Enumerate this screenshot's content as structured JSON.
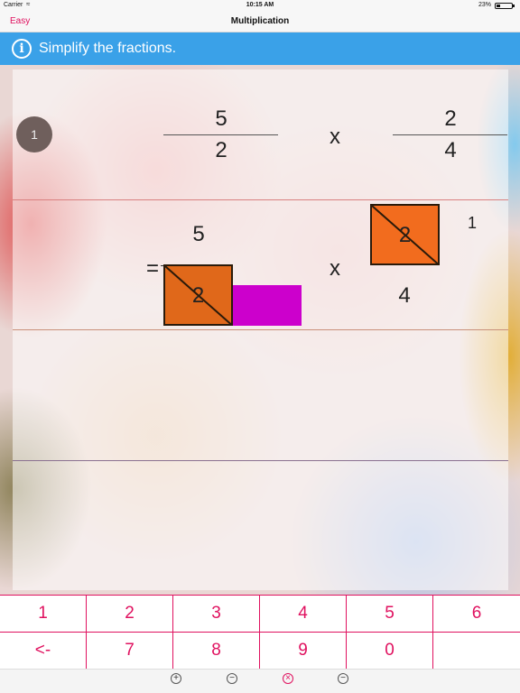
{
  "status_bar": {
    "carrier": "Carrier",
    "time": "10:15 AM",
    "battery": "23%",
    "battery_level": 0.23
  },
  "nav": {
    "back_label": "Easy",
    "title": "Multiplication"
  },
  "banner": {
    "icon": "info-icon",
    "icon_glyph": "i",
    "instruction": "Simplify the fractions."
  },
  "problem": {
    "number": "1",
    "fraction1": {
      "numerator": "5",
      "denominator": "2"
    },
    "operator": "x",
    "fraction2": {
      "numerator": "2",
      "denominator": "4"
    }
  },
  "work": {
    "equals": "=",
    "fraction1": {
      "numerator": "5",
      "denominator_crossed": "2"
    },
    "operator": "x",
    "fraction2": {
      "numerator_crossed": "2",
      "numerator_reduced": "1",
      "denominator": "4"
    }
  },
  "keypad": {
    "row1": [
      "1",
      "2",
      "3",
      "4",
      "5",
      "6"
    ],
    "row2": [
      "<-",
      "7",
      "8",
      "9",
      "0",
      ""
    ]
  },
  "toolbar": {
    "icons": [
      {
        "name": "zoom-in-icon",
        "glyph": "+"
      },
      {
        "name": "zoom-out-icon",
        "glyph": "−"
      },
      {
        "name": "clear-icon",
        "glyph": "×"
      },
      {
        "name": "minus-icon",
        "glyph": "−"
      }
    ]
  },
  "colors": {
    "accent": "#e0115f",
    "banner": "#3aa1e8",
    "crossed_box": "#e0681a",
    "input_slot": "#cc00cc",
    "row_line_top": "#d96a6a",
    "row_line_bottom": "#7a6a8a"
  }
}
